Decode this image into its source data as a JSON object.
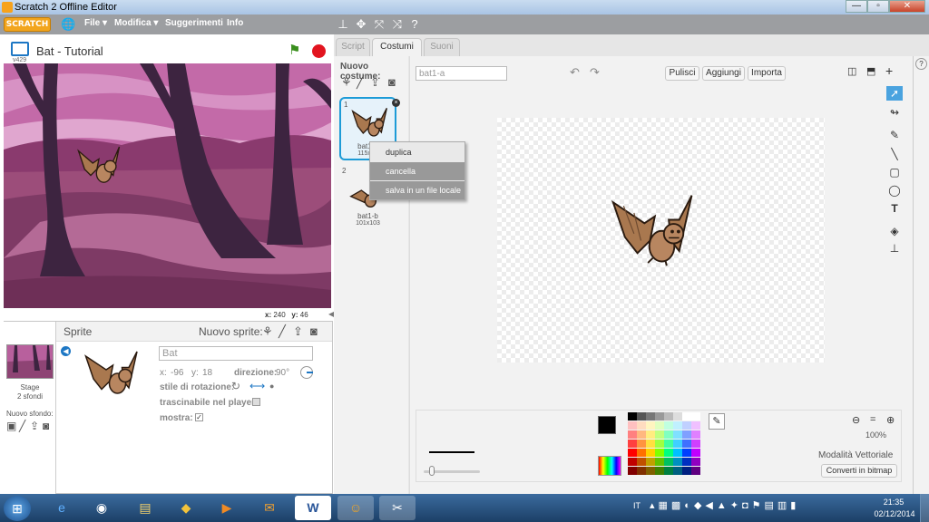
{
  "window": {
    "title": "Scratch 2 Offline Editor",
    "min": "—",
    "max": "▫",
    "close": "✕"
  },
  "menubar": {
    "logo": "SCRATCH",
    "items": [
      "File ▾",
      "Modifica ▾",
      "Suggerimenti",
      "Info"
    ]
  },
  "stage": {
    "project_name": "Bat - Tutorial",
    "version": "v429",
    "coords_x_label": "x:",
    "coords_x": "240",
    "coords_y_label": "y:",
    "coords_y": "46"
  },
  "sprite_panel": {
    "label": "Sprite",
    "new_sprite": "Nuovo sprite:",
    "stage_label": "Stage",
    "stage_backdrops": "2 sfondi",
    "new_backdrop": "Nuovo sfondo:",
    "name_value": "Bat",
    "x_label": "x:",
    "x_value": "-96",
    "y_label": "y:",
    "y_value": "18",
    "direction_label": "direzione:",
    "direction_value": "90°",
    "rotation_label": "stile di rotazione:",
    "draggable_label": "trascinabile nel player:",
    "show_label": "mostra:"
  },
  "tabs": [
    "Script",
    "Costumi",
    "Suoni"
  ],
  "costumes": {
    "header": "Nuovo costume:",
    "items": [
      {
        "index": "1",
        "name": "bat1-a",
        "size": "115x86"
      },
      {
        "index": "2",
        "name": "bat1-b",
        "size": "101x103"
      }
    ]
  },
  "context_menu": [
    "duplica",
    "cancella",
    "salva in un file locale"
  ],
  "editor": {
    "costume_name": "bat1-a",
    "buttons": [
      "Pulisci",
      "Aggiungi",
      "Importa"
    ],
    "zoom": "100%",
    "mode": "Modalità Vettoriale",
    "convert": "Converti in bitmap"
  },
  "palette": {
    "colors": [
      "#000000",
      "#555555",
      "#777777",
      "#999999",
      "#bbbbbb",
      "#dddddd",
      "#ffffff",
      "#ffffff",
      "#ffc0c0",
      "#ffdcc0",
      "#fff5c0",
      "#e0ffc0",
      "#c0ffe0",
      "#c0f0ff",
      "#c0d0ff",
      "#f0c0ff",
      "#ff8080",
      "#ffb880",
      "#ffec80",
      "#c0ff80",
      "#80ffc0",
      "#80e0ff",
      "#80a0ff",
      "#e080ff",
      "#ff4040",
      "#ff9440",
      "#ffe040",
      "#a0ff40",
      "#40ffa0",
      "#40d0ff",
      "#4070ff",
      "#d040ff",
      "#ff0000",
      "#ff7000",
      "#ffd000",
      "#80ff00",
      "#00ff80",
      "#00c0ff",
      "#0040ff",
      "#c000ff",
      "#c00000",
      "#c05000",
      "#c0a000",
      "#60c000",
      "#00c060",
      "#0090c0",
      "#0030c0",
      "#9000c0",
      "#800000",
      "#803000",
      "#806000",
      "#408000",
      "#008040",
      "#006080",
      "#002080",
      "#600080"
    ]
  },
  "taskbar": {
    "lang": "IT",
    "time": "21:35",
    "date": "02/12/2014"
  },
  "colors": {
    "accent": "#1d77c4",
    "stage_bg": "#c36aa8",
    "menubar": "#9c9ea1"
  }
}
